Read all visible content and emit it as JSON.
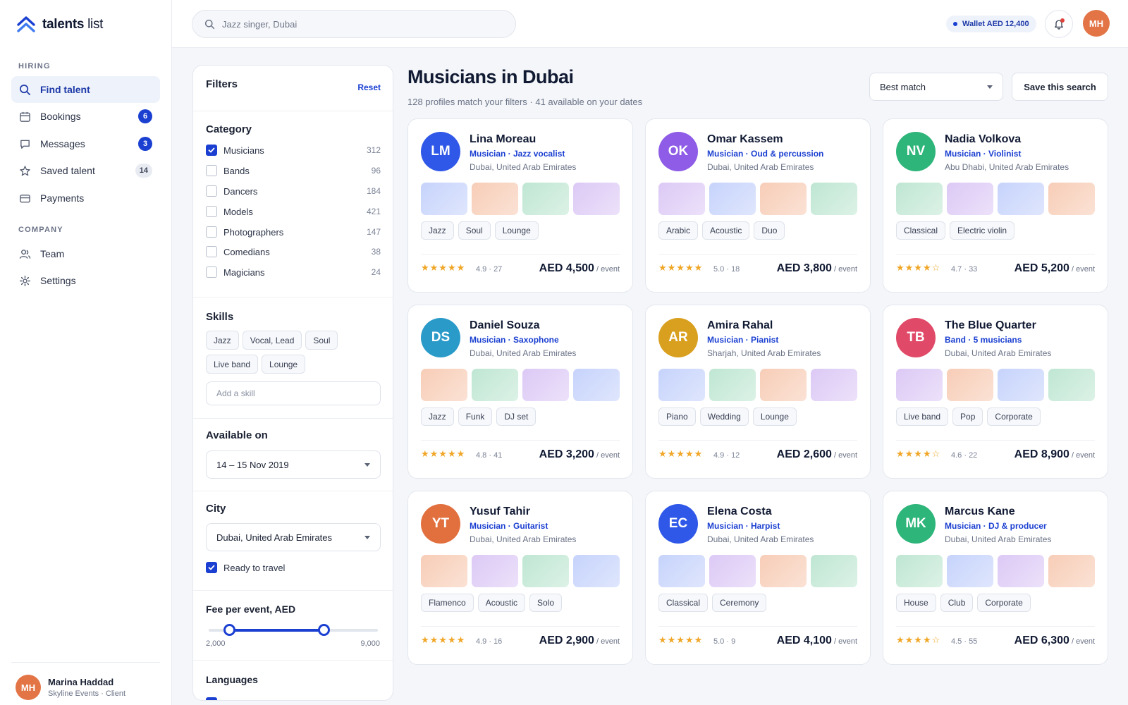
{
  "brand": {
    "bold": "talents",
    "rest": " list"
  },
  "nav": {
    "hiring_label": "HIRING",
    "company_label": "COMPANY",
    "items": [
      {
        "label": "Find talent",
        "icon": "search-icon",
        "badge": ""
      },
      {
        "label": "Bookings",
        "icon": "calendar-icon",
        "badge": "6"
      },
      {
        "label": "Messages",
        "icon": "chat-icon",
        "badge": "3"
      },
      {
        "label": "Saved talent",
        "icon": "star-icon",
        "badge": "14"
      },
      {
        "label": "Payments",
        "icon": "card-icon",
        "badge": ""
      },
      {
        "label": "Team",
        "icon": "team-icon",
        "badge": ""
      },
      {
        "label": "Settings",
        "icon": "gear-icon",
        "badge": ""
      }
    ]
  },
  "user": {
    "initials": "MH",
    "name": "Marina Haddad",
    "sub": "Skyline Events · Client"
  },
  "topbar": {
    "search_placeholder": "Jazz singer, Dubai",
    "wallet": "Wallet AED 12,400",
    "avatar": "MH"
  },
  "filters": {
    "title": "Filters",
    "reset": "Reset",
    "category_title": "Category",
    "categories": [
      {
        "label": "Musicians",
        "count": "312",
        "checked": true
      },
      {
        "label": "Bands",
        "count": "96",
        "checked": false
      },
      {
        "label": "Dancers",
        "count": "184",
        "checked": false
      },
      {
        "label": "Models",
        "count": "421",
        "checked": false
      },
      {
        "label": "Photographers",
        "count": "147",
        "checked": false
      },
      {
        "label": "Comedians",
        "count": "38",
        "checked": false
      },
      {
        "label": "Magicians",
        "count": "24",
        "checked": false
      }
    ],
    "skills_title": "Skills",
    "skills": [
      "Jazz",
      "Vocal, Lead",
      "Soul",
      "Live band",
      "Lounge"
    ],
    "skill_placeholder": "Add a skill",
    "available_title": "Available on",
    "available_value": "14 – 15 Nov 2019",
    "city_title": "City",
    "city_value": "Dubai, United Arab Emirates",
    "travel_label": "Ready to travel",
    "travel_checked": true,
    "fee_title": "Fee per event, AED",
    "fee_min": "2,000",
    "fee_max": "9,000",
    "fee_low_frac": 0.12,
    "fee_high_frac": 0.68,
    "languages_title": "Languages"
  },
  "main": {
    "title": "Musicians in Dubai",
    "subtitle": "128 profiles match your filters · 41 available on your dates",
    "sort": "Best match",
    "save": "Save this search"
  },
  "colors": {
    "accent": "#1a3fd1",
    "star": "#f0a626"
  },
  "cards": [
    {
      "initials": "LM",
      "name": "Lina Moreau",
      "role": "Musician · Jazz vocalist",
      "location": "Dubai, United Arab Emirates",
      "tags": [
        "Jazz",
        "Soul",
        "Lounge"
      ],
      "stars": "★★★★★",
      "rating": "4.9 · 27",
      "price": "AED 4,500",
      "unit": " / event",
      "avatar_color": "#2f58e8",
      "thumbs": [
        "t-blue",
        "t-peach",
        "t-mint",
        "t-violet"
      ]
    },
    {
      "initials": "OK",
      "name": "Omar Kassem",
      "role": "Musician · Oud & percussion",
      "location": "Dubai, United Arab Emirates",
      "tags": [
        "Arabic",
        "Acoustic",
        "Duo"
      ],
      "stars": "★★★★★",
      "rating": "5.0 · 18",
      "price": "AED 3,800",
      "unit": " / event",
      "avatar_color": "#8e5ce6",
      "thumbs": [
        "t-violet",
        "t-blue",
        "t-peach",
        "t-mint"
      ]
    },
    {
      "initials": "NV",
      "name": "Nadia Volkova",
      "role": "Musician · Violinist",
      "location": "Abu Dhabi, United Arab Emirates",
      "tags": [
        "Classical",
        "Electric violin"
      ],
      "stars": "★★★★☆",
      "rating": "4.7 · 33",
      "price": "AED 5,200",
      "unit": " / event",
      "avatar_color": "#2eb57a",
      "thumbs": [
        "t-mint",
        "t-violet",
        "t-blue",
        "t-peach"
      ]
    },
    {
      "initials": "DS",
      "name": "Daniel Souza",
      "role": "Musician · Saxophone",
      "location": "Dubai, United Arab Emirates",
      "tags": [
        "Jazz",
        "Funk",
        "DJ set"
      ],
      "stars": "★★★★★",
      "rating": "4.8 · 41",
      "price": "AED 3,200",
      "unit": " / event",
      "avatar_color": "#2a9ac9",
      "thumbs": [
        "t-peach",
        "t-mint",
        "t-violet",
        "t-blue"
      ]
    },
    {
      "initials": "AR",
      "name": "Amira Rahal",
      "role": "Musician · Pianist",
      "location": "Sharjah, United Arab Emirates",
      "tags": [
        "Piano",
        "Wedding",
        "Lounge"
      ],
      "stars": "★★★★★",
      "rating": "4.9 · 12",
      "price": "AED 2,600",
      "unit": " / event",
      "avatar_color": "#d9a01f",
      "thumbs": [
        "t-blue",
        "t-mint",
        "t-peach",
        "t-violet"
      ]
    },
    {
      "initials": "TB",
      "name": "The Blue Quarter",
      "role": "Band · 5 musicians",
      "location": "Dubai, United Arab Emirates",
      "tags": [
        "Live band",
        "Pop",
        "Corporate"
      ],
      "stars": "★★★★☆",
      "rating": "4.6 · 22",
      "price": "AED 8,900",
      "unit": " / event",
      "avatar_color": "#e04a68",
      "thumbs": [
        "t-violet",
        "t-peach",
        "t-blue",
        "t-mint"
      ]
    },
    {
      "initials": "YT",
      "name": "Yusuf Tahir",
      "role": "Musician · Guitarist",
      "location": "Dubai, United Arab Emirates",
      "tags": [
        "Flamenco",
        "Acoustic",
        "Solo"
      ],
      "stars": "★★★★★",
      "rating": "4.9 · 16",
      "price": "AED 2,900",
      "unit": " / event",
      "avatar_color": "#e2703f",
      "thumbs": [
        "t-peach",
        "t-violet",
        "t-mint",
        "t-blue"
      ]
    },
    {
      "initials": "EC",
      "name": "Elena Costa",
      "role": "Musician · Harpist",
      "location": "Dubai, United Arab Emirates",
      "tags": [
        "Classical",
        "Ceremony"
      ],
      "stars": "★★★★★",
      "rating": "5.0 · 9",
      "price": "AED 4,100",
      "unit": " / event",
      "avatar_color": "#2f58e8",
      "thumbs": [
        "t-blue",
        "t-violet",
        "t-peach",
        "t-mint"
      ]
    },
    {
      "initials": "MK",
      "name": "Marcus Kane",
      "role": "Musician · DJ & producer",
      "location": "Dubai, United Arab Emirates",
      "tags": [
        "House",
        "Club",
        "Corporate"
      ],
      "stars": "★★★★☆",
      "rating": "4.5 · 55",
      "price": "AED 6,300",
      "unit": " / event",
      "avatar_color": "#2eb57a",
      "thumbs": [
        "t-mint",
        "t-blue",
        "t-violet",
        "t-peach"
      ]
    }
  ]
}
